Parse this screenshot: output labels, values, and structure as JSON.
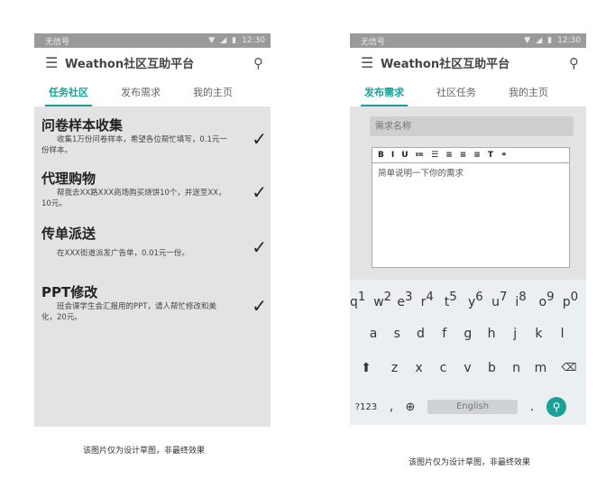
{
  "left_phone": {
    "status": {
      "carrier": "无信号",
      "time": "12:30"
    },
    "app_title": "Weathon社区互助平台",
    "tabs": [
      {
        "label": "任务社区",
        "active": true
      },
      {
        "label": "发布需求",
        "active": false
      },
      {
        "label": "我的主页",
        "active": false
      }
    ],
    "tasks": [
      {
        "title": "问卷样本收集",
        "desc": "收集1万份问卷样本，希望各位帮忙填写，0.1元一份样本。"
      },
      {
        "title": "代理购物",
        "desc": "帮我去XX路XXX商场购买烧饼10个，并送至XX，10元。"
      },
      {
        "title": "传单派送",
        "desc": "在XXX街道派发广告单，0.01元一份。"
      },
      {
        "title": "PPT修改",
        "desc": "班会课学生会汇报用的PPT，请人帮忙修改和美化，20元。"
      }
    ],
    "check_glyph": "✓",
    "caption": "该图片仅为设计草图，非最终效果"
  },
  "right_phone": {
    "status": {
      "carrier": "无信号",
      "time": "12:30"
    },
    "app_title": "Weathon社区互助平台",
    "tabs": [
      {
        "label": "发布需求",
        "active": true
      },
      {
        "label": "社区任务",
        "active": false
      },
      {
        "label": "我的主页",
        "active": false
      }
    ],
    "name_placeholder": "需求名称",
    "toolbar": [
      "B",
      "I",
      "U",
      "≔",
      "☰",
      "≡",
      "≡",
      "≡",
      "T",
      "⚭"
    ],
    "editor_placeholder": "简单说明一下你的需求",
    "keyboard": {
      "row1": [
        "q",
        "w",
        "e",
        "r",
        "t",
        "y",
        "u",
        "i",
        "o",
        "p"
      ],
      "row1_hints": [
        "1",
        "2",
        "3",
        "4",
        "5",
        "6",
        "7",
        "8",
        "9",
        "0"
      ],
      "row2": [
        "a",
        "s",
        "d",
        "f",
        "g",
        "h",
        "j",
        "k",
        "l"
      ],
      "row3": [
        "z",
        "x",
        "c",
        "v",
        "b",
        "n",
        "m"
      ],
      "shift": "⬆",
      "backspace": "⌫",
      "symbols": "?123",
      "comma": ",",
      "globe": "⊕",
      "space_label": "English",
      "period": ".",
      "go": "⚲"
    },
    "caption": "该图片仅为设计草图，非最终效果"
  }
}
